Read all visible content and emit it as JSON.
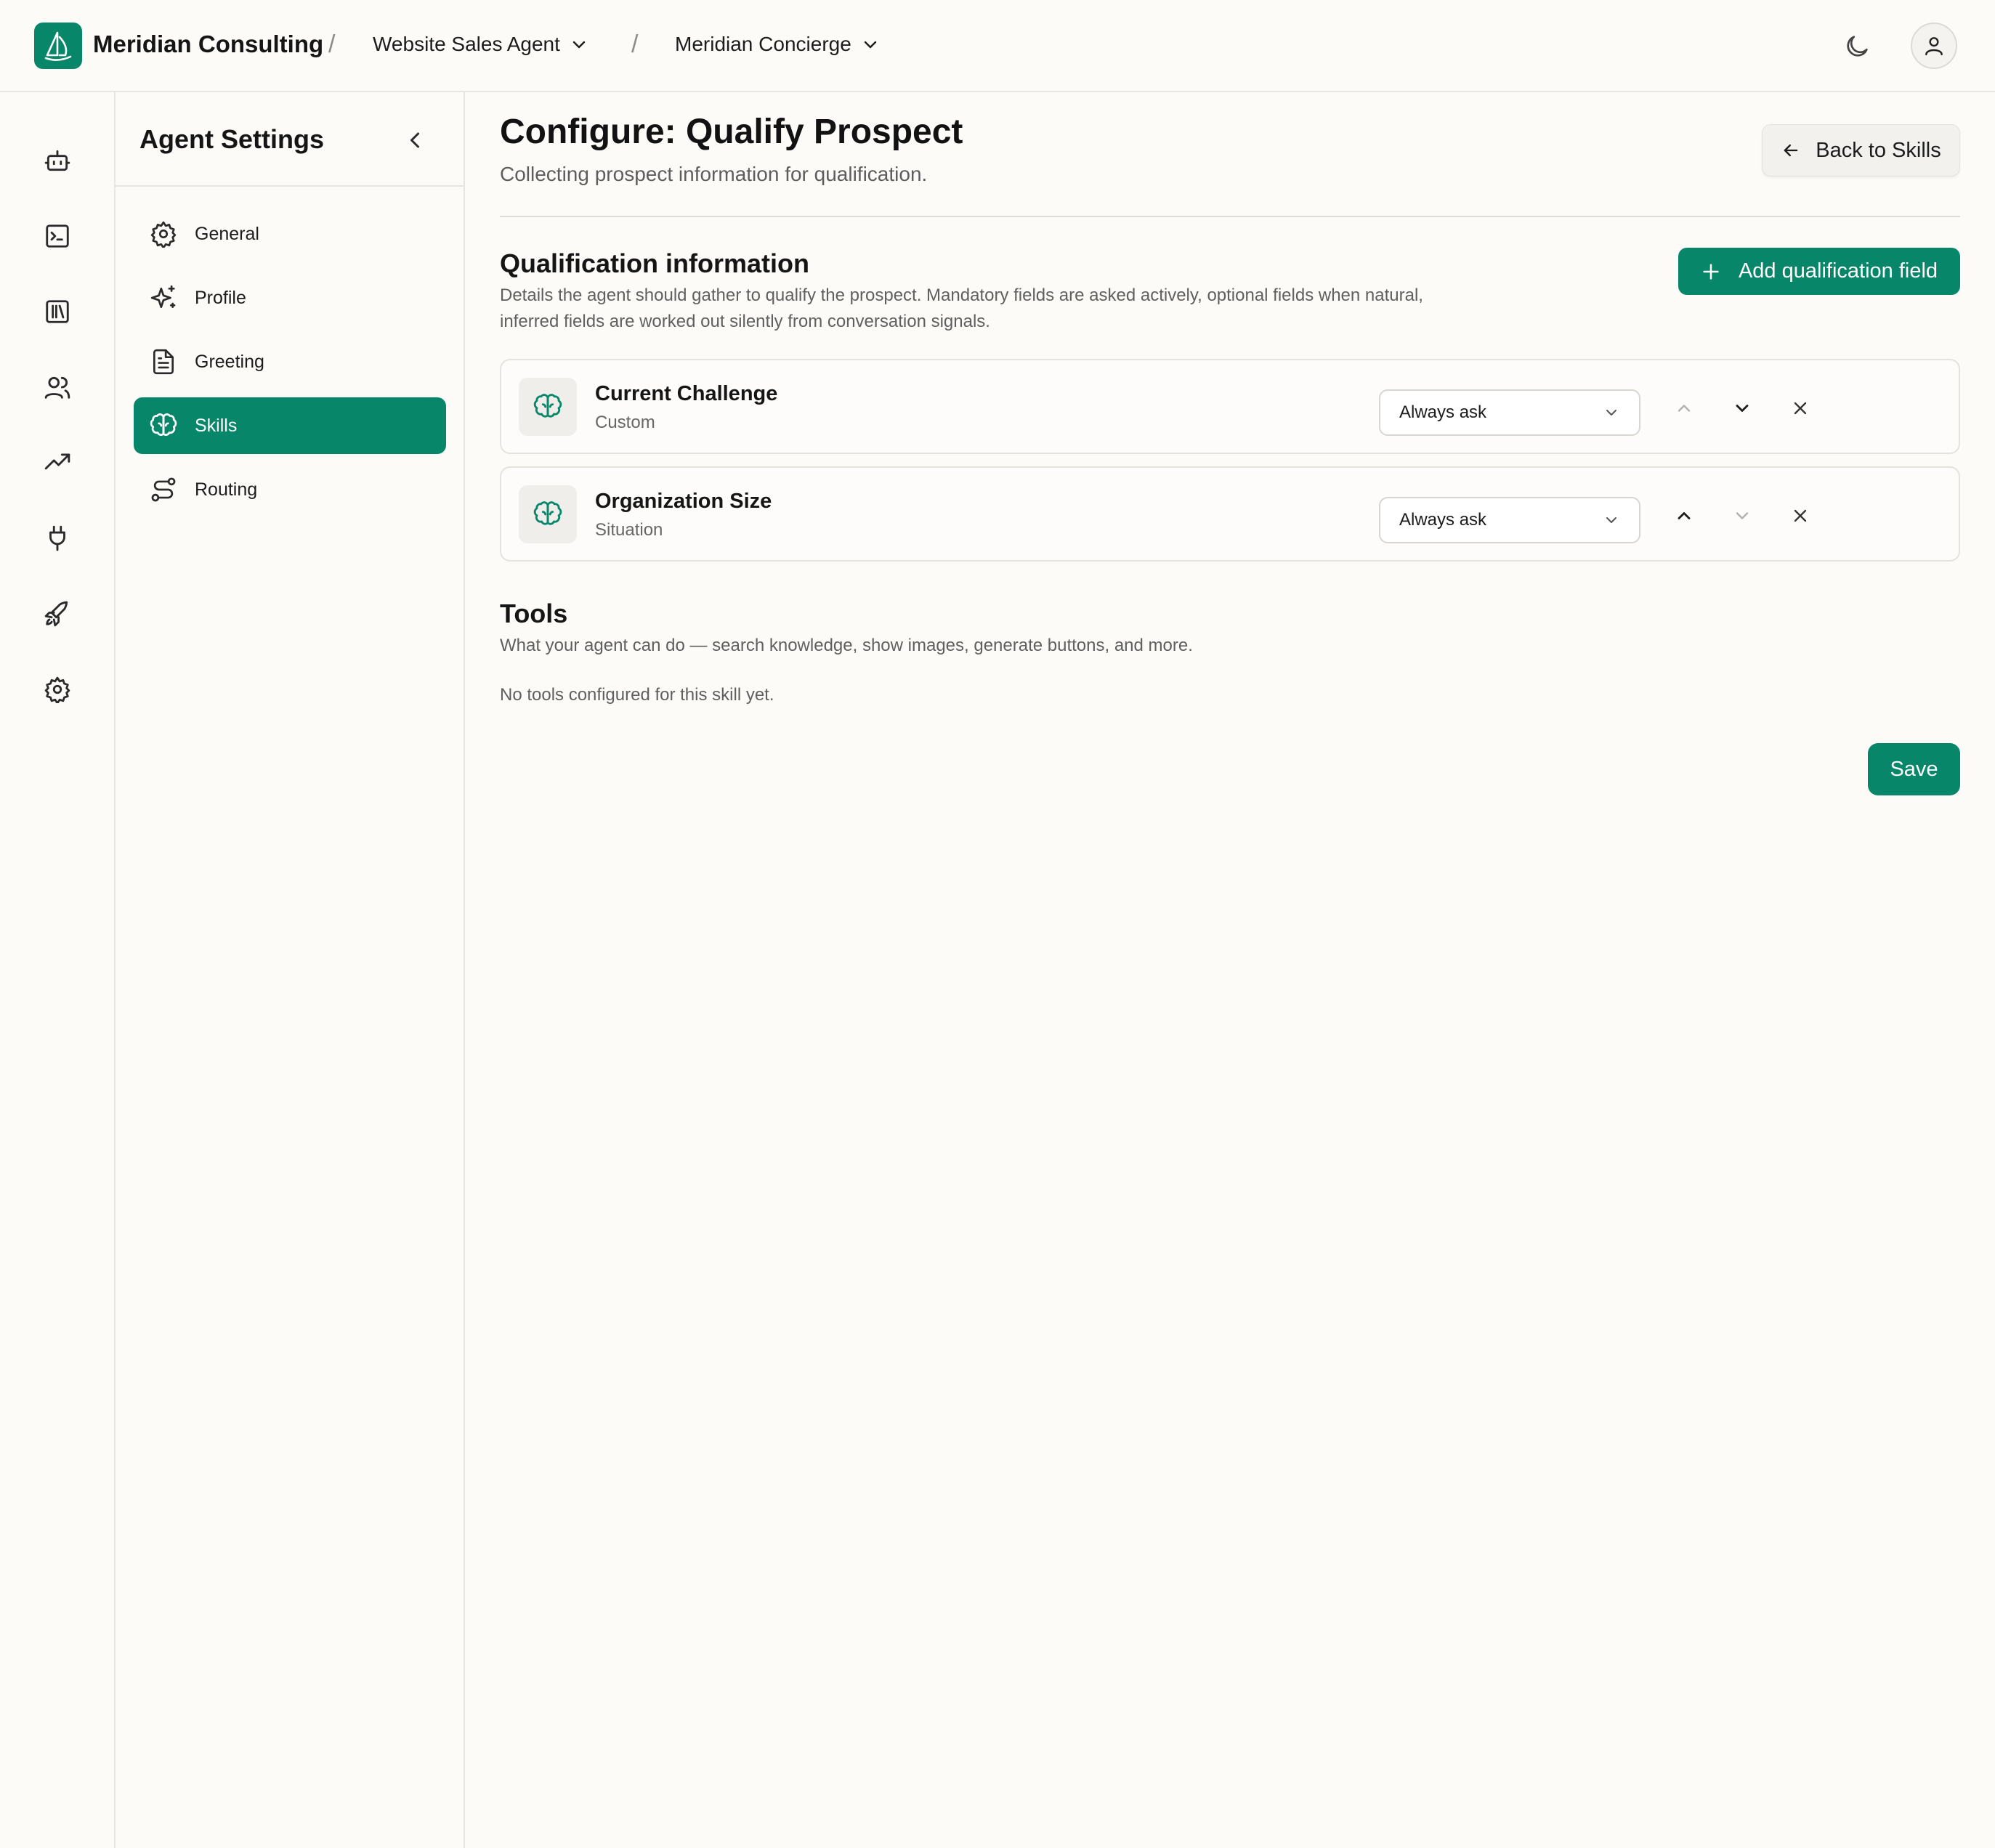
{
  "header": {
    "org_name": "Meridian Consulting",
    "separator": "/",
    "crumbs": [
      {
        "label": "Website Sales Agent"
      },
      {
        "label": "Meridian Concierge"
      }
    ]
  },
  "rail": {
    "items": [
      "robot-icon",
      "terminal-icon",
      "library-icon",
      "users-icon",
      "trending-up-icon",
      "plug-icon",
      "rocket-icon",
      "gear-icon"
    ]
  },
  "sidebar": {
    "title": "Agent Settings",
    "items": [
      {
        "label": "General",
        "icon": "gear-icon"
      },
      {
        "label": "Profile",
        "icon": "sparkles-icon"
      },
      {
        "label": "Greeting",
        "icon": "document-icon"
      },
      {
        "label": "Skills",
        "icon": "brain-icon",
        "active": true
      },
      {
        "label": "Routing",
        "icon": "route-icon"
      }
    ]
  },
  "main": {
    "title": "Configure: Qualify Prospect",
    "subtitle": "Collecting prospect information for qualification.",
    "back_label": "Back to Skills",
    "qualification": {
      "title": "Qualification information",
      "description": "Details the agent should gather to qualify the prospect. Mandatory fields are asked actively, optional fields when natural, inferred fields are worked out silently from conversation signals.",
      "add_label": "Add qualification field",
      "fields": [
        {
          "name": "Current Challenge",
          "type": "Custom",
          "mode": "Always ask"
        },
        {
          "name": "Organization Size",
          "type": "Situation",
          "mode": "Always ask"
        }
      ]
    },
    "tools": {
      "title": "Tools",
      "description": "What your agent can do — search knowledge, show images, generate buttons, and more.",
      "empty": "No tools configured for this skill yet."
    },
    "save_label": "Save"
  },
  "colors": {
    "accent": "#07866a",
    "background": "#fcfbf8",
    "border": "#e7e5df"
  }
}
